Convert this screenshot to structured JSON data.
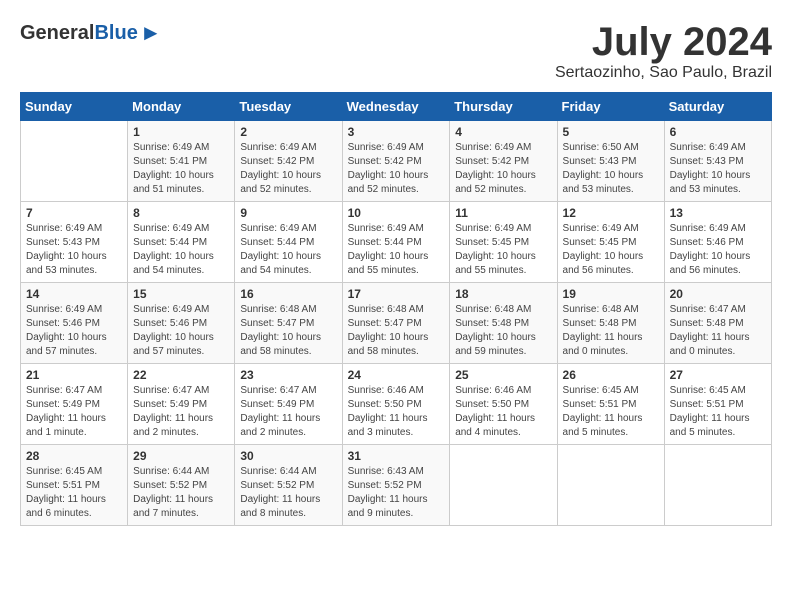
{
  "header": {
    "logo_general": "General",
    "logo_blue": "Blue",
    "month_year": "July 2024",
    "location": "Sertaozinho, Sao Paulo, Brazil"
  },
  "days_of_week": [
    "Sunday",
    "Monday",
    "Tuesday",
    "Wednesday",
    "Thursday",
    "Friday",
    "Saturday"
  ],
  "weeks": [
    [
      {
        "day": "",
        "info": ""
      },
      {
        "day": "1",
        "info": "Sunrise: 6:49 AM\nSunset: 5:41 PM\nDaylight: 10 hours\nand 51 minutes."
      },
      {
        "day": "2",
        "info": "Sunrise: 6:49 AM\nSunset: 5:42 PM\nDaylight: 10 hours\nand 52 minutes."
      },
      {
        "day": "3",
        "info": "Sunrise: 6:49 AM\nSunset: 5:42 PM\nDaylight: 10 hours\nand 52 minutes."
      },
      {
        "day": "4",
        "info": "Sunrise: 6:49 AM\nSunset: 5:42 PM\nDaylight: 10 hours\nand 52 minutes."
      },
      {
        "day": "5",
        "info": "Sunrise: 6:50 AM\nSunset: 5:43 PM\nDaylight: 10 hours\nand 53 minutes."
      },
      {
        "day": "6",
        "info": "Sunrise: 6:49 AM\nSunset: 5:43 PM\nDaylight: 10 hours\nand 53 minutes."
      }
    ],
    [
      {
        "day": "7",
        "info": "Sunrise: 6:49 AM\nSunset: 5:43 PM\nDaylight: 10 hours\nand 53 minutes."
      },
      {
        "day": "8",
        "info": "Sunrise: 6:49 AM\nSunset: 5:44 PM\nDaylight: 10 hours\nand 54 minutes."
      },
      {
        "day": "9",
        "info": "Sunrise: 6:49 AM\nSunset: 5:44 PM\nDaylight: 10 hours\nand 54 minutes."
      },
      {
        "day": "10",
        "info": "Sunrise: 6:49 AM\nSunset: 5:44 PM\nDaylight: 10 hours\nand 55 minutes."
      },
      {
        "day": "11",
        "info": "Sunrise: 6:49 AM\nSunset: 5:45 PM\nDaylight: 10 hours\nand 55 minutes."
      },
      {
        "day": "12",
        "info": "Sunrise: 6:49 AM\nSunset: 5:45 PM\nDaylight: 10 hours\nand 56 minutes."
      },
      {
        "day": "13",
        "info": "Sunrise: 6:49 AM\nSunset: 5:46 PM\nDaylight: 10 hours\nand 56 minutes."
      }
    ],
    [
      {
        "day": "14",
        "info": "Sunrise: 6:49 AM\nSunset: 5:46 PM\nDaylight: 10 hours\nand 57 minutes."
      },
      {
        "day": "15",
        "info": "Sunrise: 6:49 AM\nSunset: 5:46 PM\nDaylight: 10 hours\nand 57 minutes."
      },
      {
        "day": "16",
        "info": "Sunrise: 6:48 AM\nSunset: 5:47 PM\nDaylight: 10 hours\nand 58 minutes."
      },
      {
        "day": "17",
        "info": "Sunrise: 6:48 AM\nSunset: 5:47 PM\nDaylight: 10 hours\nand 58 minutes."
      },
      {
        "day": "18",
        "info": "Sunrise: 6:48 AM\nSunset: 5:48 PM\nDaylight: 10 hours\nand 59 minutes."
      },
      {
        "day": "19",
        "info": "Sunrise: 6:48 AM\nSunset: 5:48 PM\nDaylight: 11 hours\nand 0 minutes."
      },
      {
        "day": "20",
        "info": "Sunrise: 6:47 AM\nSunset: 5:48 PM\nDaylight: 11 hours\nand 0 minutes."
      }
    ],
    [
      {
        "day": "21",
        "info": "Sunrise: 6:47 AM\nSunset: 5:49 PM\nDaylight: 11 hours\nand 1 minute."
      },
      {
        "day": "22",
        "info": "Sunrise: 6:47 AM\nSunset: 5:49 PM\nDaylight: 11 hours\nand 2 minutes."
      },
      {
        "day": "23",
        "info": "Sunrise: 6:47 AM\nSunset: 5:49 PM\nDaylight: 11 hours\nand 2 minutes."
      },
      {
        "day": "24",
        "info": "Sunrise: 6:46 AM\nSunset: 5:50 PM\nDaylight: 11 hours\nand 3 minutes."
      },
      {
        "day": "25",
        "info": "Sunrise: 6:46 AM\nSunset: 5:50 PM\nDaylight: 11 hours\nand 4 minutes."
      },
      {
        "day": "26",
        "info": "Sunrise: 6:45 AM\nSunset: 5:51 PM\nDaylight: 11 hours\nand 5 minutes."
      },
      {
        "day": "27",
        "info": "Sunrise: 6:45 AM\nSunset: 5:51 PM\nDaylight: 11 hours\nand 5 minutes."
      }
    ],
    [
      {
        "day": "28",
        "info": "Sunrise: 6:45 AM\nSunset: 5:51 PM\nDaylight: 11 hours\nand 6 minutes."
      },
      {
        "day": "29",
        "info": "Sunrise: 6:44 AM\nSunset: 5:52 PM\nDaylight: 11 hours\nand 7 minutes."
      },
      {
        "day": "30",
        "info": "Sunrise: 6:44 AM\nSunset: 5:52 PM\nDaylight: 11 hours\nand 8 minutes."
      },
      {
        "day": "31",
        "info": "Sunrise: 6:43 AM\nSunset: 5:52 PM\nDaylight: 11 hours\nand 9 minutes."
      },
      {
        "day": "",
        "info": ""
      },
      {
        "day": "",
        "info": ""
      },
      {
        "day": "",
        "info": ""
      }
    ]
  ]
}
